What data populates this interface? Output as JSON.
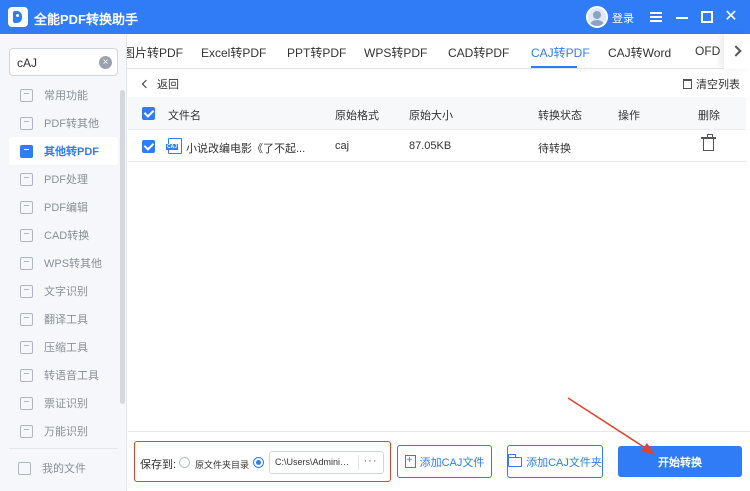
{
  "app": {
    "title": "全能PDF转换助手",
    "login_label": "登录",
    "brand_color": "#2f7cf6",
    "icons": [
      "app-logo-icon",
      "user-avatar-icon",
      "menu-icon",
      "minimize-icon",
      "maximize-icon",
      "close-icon"
    ],
    "close_glyph": "✕"
  },
  "sidebar": {
    "search": {
      "value": "cAJ",
      "clear_glyph": "×"
    },
    "items": [
      {
        "label": "常用功能",
        "icon": "star-icon"
      },
      {
        "label": "PDF转其他",
        "icon": "pdf-icon"
      },
      {
        "label": "其他转PDF",
        "icon": "convert-icon",
        "active": true
      },
      {
        "label": "PDF处理",
        "icon": "process-icon"
      },
      {
        "label": "PDF编辑",
        "icon": "edit-icon"
      },
      {
        "label": "CAD转换",
        "icon": "cad-icon"
      },
      {
        "label": "WPS转其他",
        "icon": "wps-icon"
      },
      {
        "label": "文字识别",
        "icon": "ocr-icon"
      },
      {
        "label": "翻译工具",
        "icon": "translate-icon"
      },
      {
        "label": "压缩工具",
        "icon": "compress-icon"
      },
      {
        "label": "转语音工具",
        "icon": "speech-icon"
      },
      {
        "label": "票证识别",
        "icon": "ticket-icon"
      },
      {
        "label": "万能识别",
        "icon": "scan-icon"
      }
    ],
    "my_files": "我的文件"
  },
  "tabs": [
    {
      "label": "图片转PDF"
    },
    {
      "label": "Excel转PDF"
    },
    {
      "label": "PPT转PDF"
    },
    {
      "label": "WPS转PDF"
    },
    {
      "label": "CAD转PDF"
    },
    {
      "label": "CAJ转PDF",
      "active": true
    },
    {
      "label": "CAJ转Word"
    },
    {
      "label": "OFD"
    }
  ],
  "content": {
    "back_label": "返回",
    "clear_list_label": "清空列表",
    "table": {
      "headers": [
        "文件名",
        "原始格式",
        "原始大小",
        "转换状态",
        "操作",
        "删除"
      ],
      "rows": [
        {
          "checked": true,
          "file_badge": "CAJ",
          "file_name": "小说改编电影《了不起...",
          "format": "caj",
          "size": "87.05KB",
          "status": "待转换",
          "action": ""
        }
      ]
    }
  },
  "bottom": {
    "save_to_label": "保存到:",
    "option_source_folder": "原文件夹目录",
    "path_value": "C:\\Users\\Administrator\\Desktop",
    "path_more": "···",
    "add_file_button": "添加CAJ文件",
    "add_folder_button": "添加CAJ文件夹",
    "start_button": "开始转换",
    "highlight_color": "#e0432f"
  }
}
